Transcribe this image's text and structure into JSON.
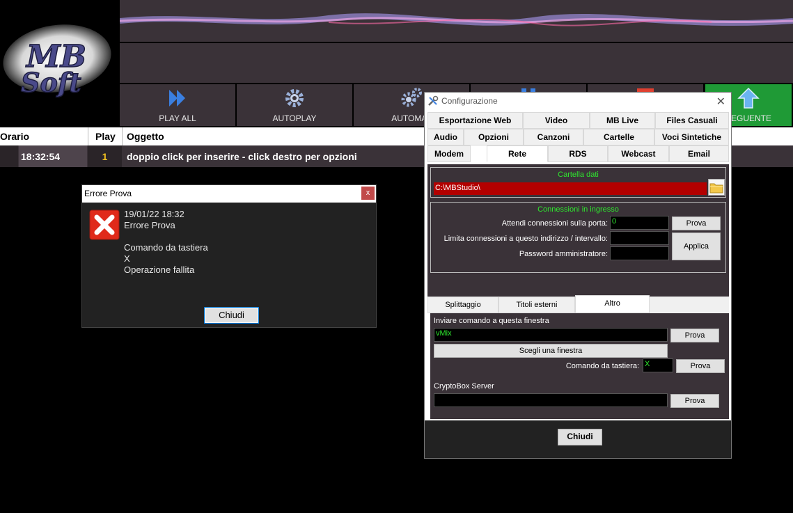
{
  "logo": {
    "text": "MB Soft"
  },
  "toolbar": {
    "buttons": [
      {
        "label": "PLAY ALL",
        "icon": "play-all-icon"
      },
      {
        "label": "AUTOPLAY",
        "icon": "gear-icon"
      },
      {
        "label": "AUTOMAT",
        "icon": "gears-icon"
      },
      {
        "label": "",
        "icon": "pause-icon"
      },
      {
        "label": "",
        "icon": "stop-icon"
      },
      {
        "label": "SEGUENTE",
        "icon": "arrow-up-icon"
      }
    ]
  },
  "playlist": {
    "columns": [
      "Orario",
      "Play",
      "Oggetto"
    ],
    "rows": [
      {
        "time": "18:32:54",
        "play": "1",
        "object": "doppio click per inserire - click destro per opzioni"
      }
    ]
  },
  "error_dialog": {
    "title": "Errore Prova",
    "close": "x",
    "lines": [
      "19/01/22 18:32",
      "Errore Prova",
      "",
      "Comando da tastiera",
      "X",
      "Operazione fallita"
    ],
    "button": "Chiudi"
  },
  "config": {
    "title": "Configurazione",
    "tabs_row1": [
      "Esportazione Web",
      "Video",
      "MB Live",
      "Files Casuali"
    ],
    "tabs_row2": [
      "Audio",
      "Opzioni",
      "Canzoni",
      "Cartelle",
      "Voci Sintetiche"
    ],
    "tabs_row3": [
      "Modem",
      "Rete",
      "RDS",
      "Webcast",
      "Email"
    ],
    "selected_tab": "Rete",
    "data_folder": {
      "title": "Cartella dati",
      "value": "C:\\MBStudio\\"
    },
    "incoming": {
      "title": "Connessioni in ingresso",
      "port_label": "Attendi connessioni sulla porta:",
      "port_value": "0",
      "limit_label": "Limita connessioni a questo indirizzo / intervallo:",
      "limit_value": "",
      "password_label": "Password amministratore:",
      "password_value": "",
      "test_button": "Prova",
      "apply_button": "Applica"
    },
    "subtabs": [
      "Splittaggio",
      "Titoli esterni",
      "Altro"
    ],
    "selected_subtab": "Altro",
    "altro": {
      "send_label": "Inviare comando a questa finestra",
      "send_value": "vMix",
      "send_test": "Prova",
      "choose_window": "Scegli una finestra",
      "keyboard_label": "Comando da tastiera:",
      "keyboard_value": "X",
      "keyboard_test": "Prova",
      "cryptobox_label": "CryptoBox Server",
      "cryptobox_value": "",
      "cryptobox_test": "Prova"
    },
    "close_button": "Chiudi"
  },
  "colors": {
    "panel": "#3a3238",
    "green_button": "#1f9a36",
    "accent_green_text": "#2ee82e",
    "folder_field": "#b30000"
  }
}
